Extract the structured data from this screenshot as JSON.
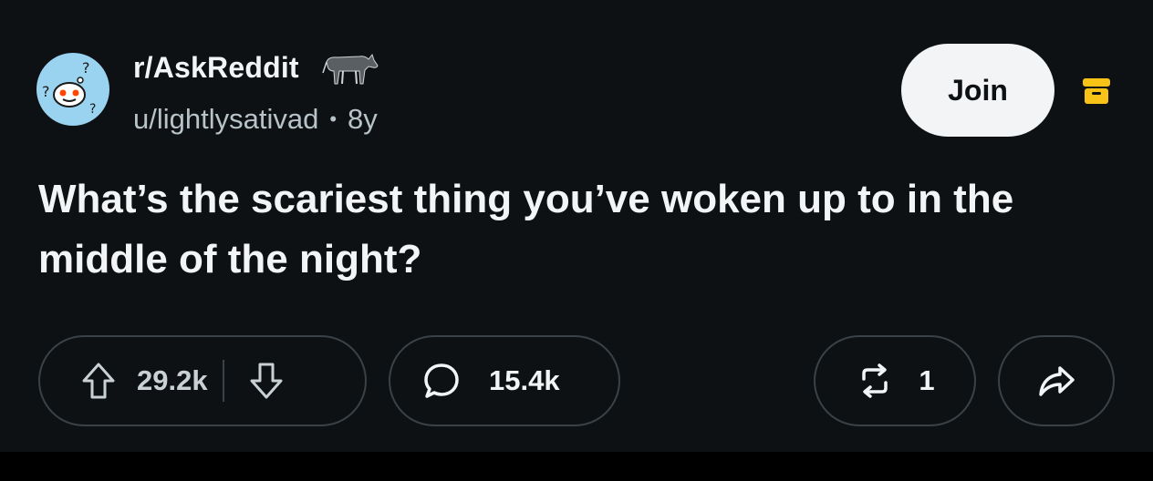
{
  "post": {
    "subreddit": "r/AskReddit",
    "author": "u/lightlysativad",
    "age": "8y",
    "title": "What’s the scariest thing you’ve woken up to in the middle of the night?"
  },
  "actions": {
    "join_label": "Join",
    "upvotes": "29.2k",
    "comments": "15.4k",
    "crossposts": "1"
  },
  "icons": {
    "avatar": "subreddit-avatar-icon",
    "flair": "donkey-icon",
    "archive": "archive-icon",
    "upvote": "upvote-arrow-icon",
    "downvote": "downvote-arrow-icon",
    "comment": "comment-bubble-icon",
    "crosspost": "crosspost-icon",
    "share": "share-arrow-icon"
  },
  "colors": {
    "background": "#0e1113",
    "text": "#f2f4f5",
    "muted": "#b7c3c9",
    "archive_accent": "#f7c317",
    "join_button": "#f2f4f5",
    "pill_border": "#3a4247"
  }
}
